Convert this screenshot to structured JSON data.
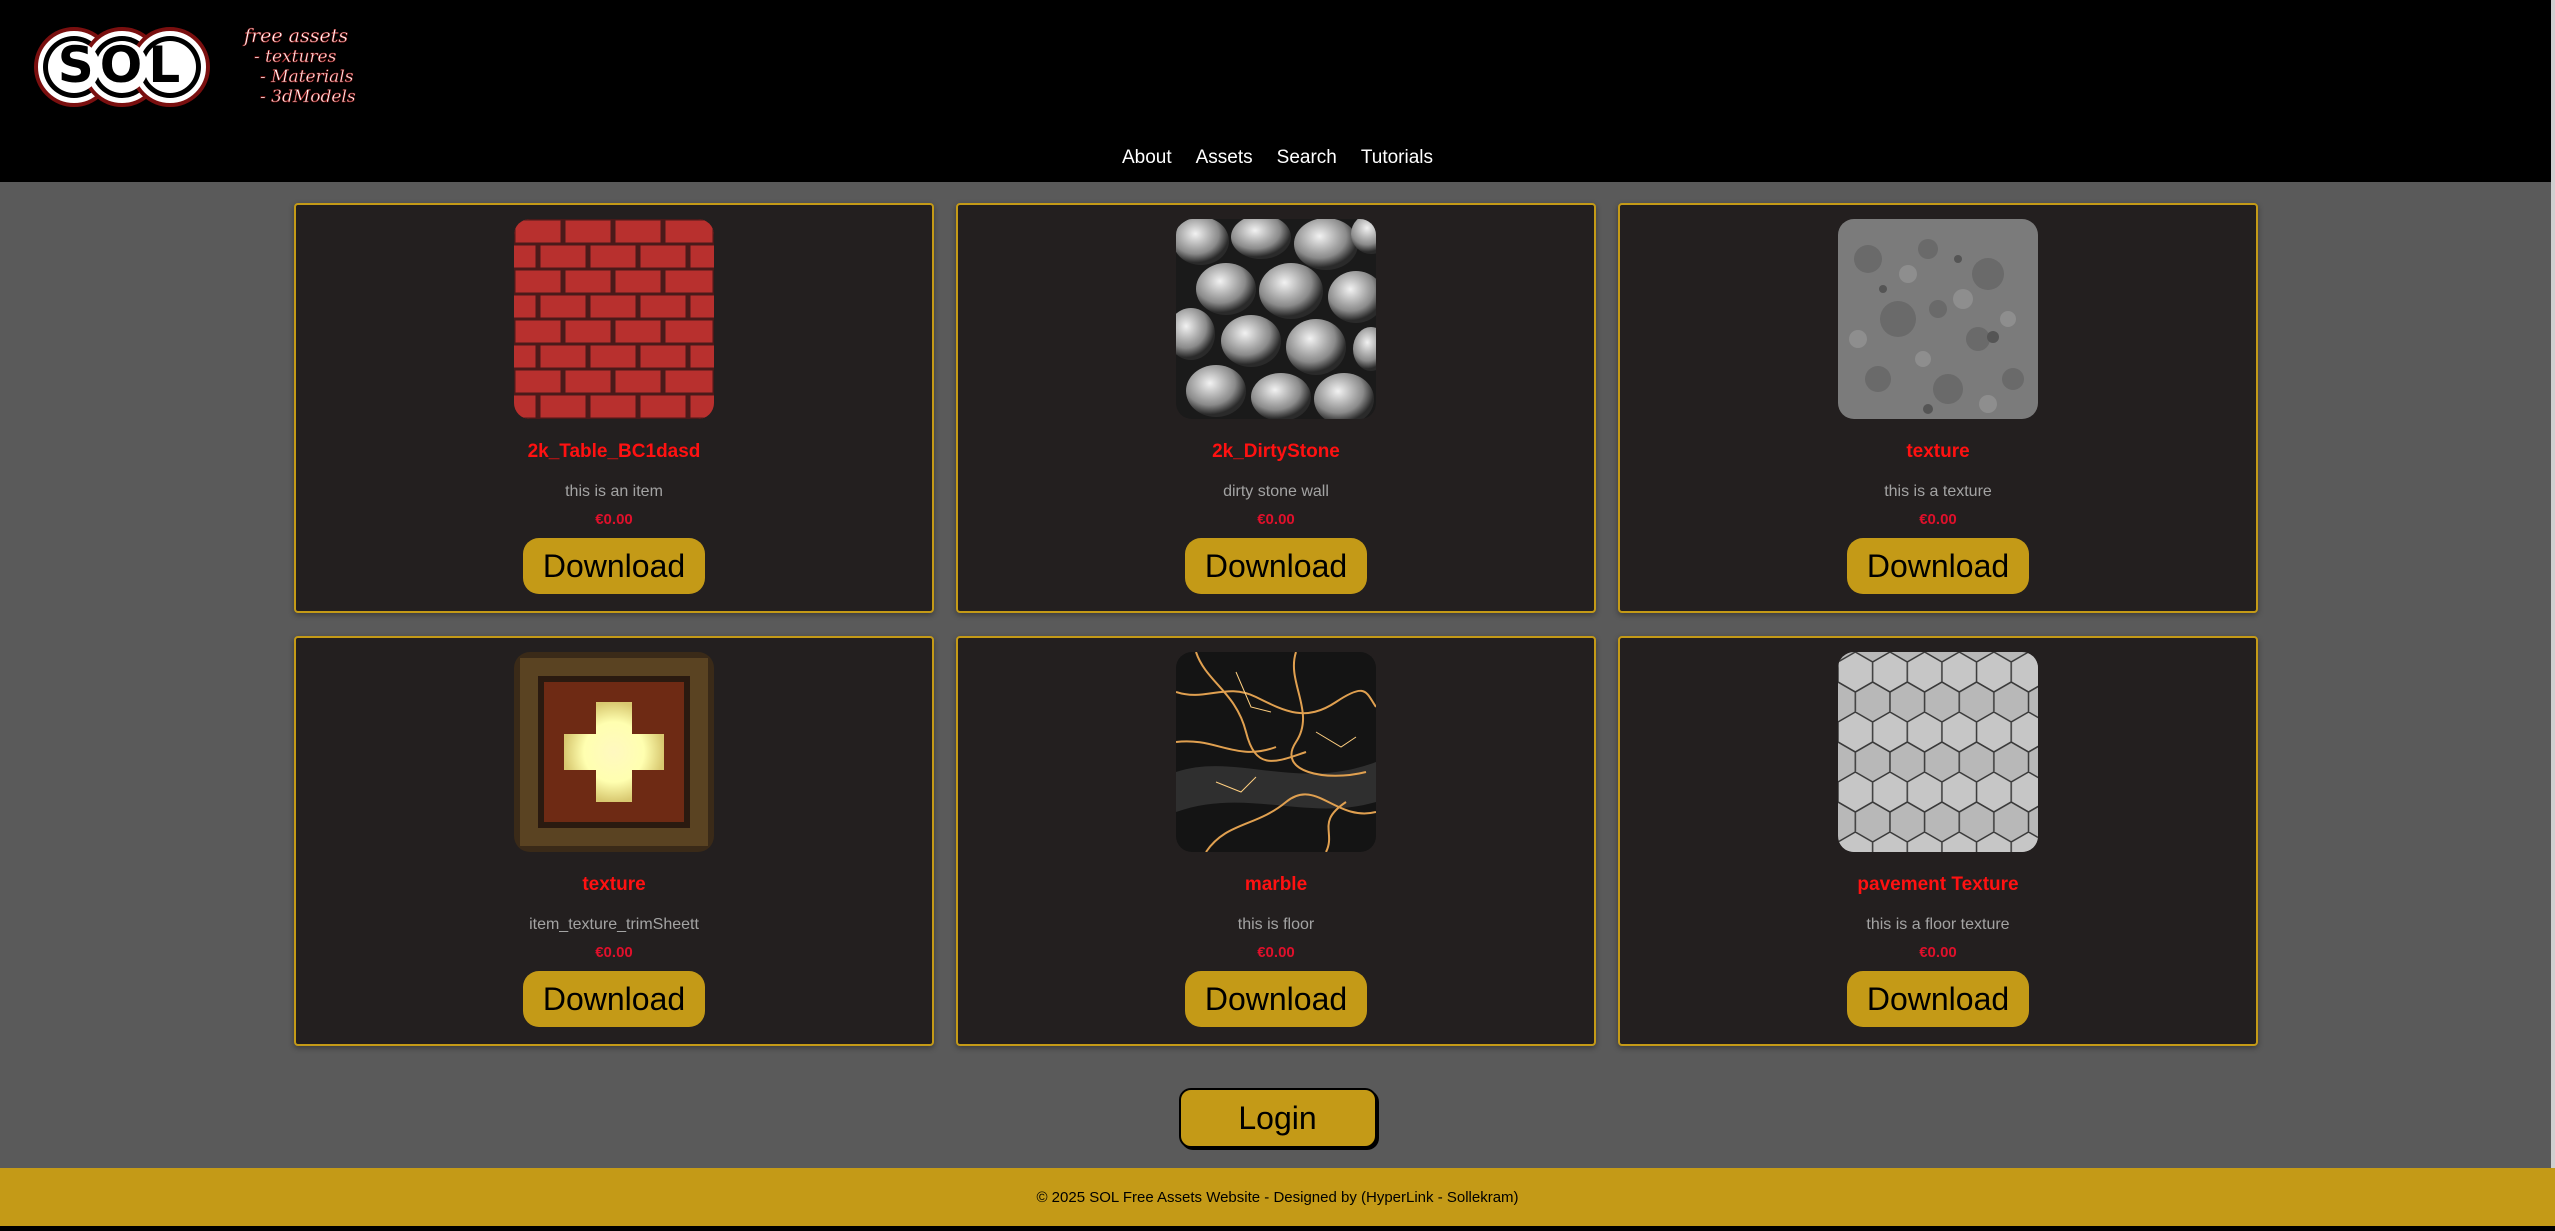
{
  "header": {
    "logo_text": "SOL",
    "logo_tagline": [
      "free assets",
      "- textures",
      "- Materials",
      "- 3dModels"
    ]
  },
  "nav": {
    "items": [
      {
        "label": "About"
      },
      {
        "label": "Assets"
      },
      {
        "label": "Search"
      },
      {
        "label": "Tutorials"
      }
    ]
  },
  "assets": [
    {
      "title": "2k_Table_BC1dasd",
      "description": "this is an item",
      "price": "€0.00",
      "button": "Download",
      "thumb": "red-brick-texture"
    },
    {
      "title": "2k_DirtyStone",
      "description": "dirty stone wall",
      "price": "€0.00",
      "button": "Download",
      "thumb": "dirty-stone-texture"
    },
    {
      "title": "texture",
      "description": "this is a texture",
      "price": "€0.00",
      "button": "Download",
      "thumb": "gray-concrete-texture"
    },
    {
      "title": "texture",
      "description": "item_texture_trimSheett",
      "price": "€0.00",
      "button": "Download",
      "thumb": "glowing-cross-tile-texture"
    },
    {
      "title": "marble",
      "description": "this is floor",
      "price": "€0.00",
      "button": "Download",
      "thumb": "black-gold-marble-texture"
    },
    {
      "title": "pavement Texture",
      "description": "this is a floor texture",
      "price": "€0.00",
      "button": "Download",
      "thumb": "hexagon-pavement-texture"
    }
  ],
  "login": {
    "label": "Login"
  },
  "footer": {
    "text": "© 2025 SOL Free Assets Website - Designed by (HyperLink - Sollekram)"
  },
  "colors": {
    "accent": "#c49a17",
    "card_bg": "#231f1f",
    "page_bg": "#5a5a5a",
    "title_red": "#ff1111",
    "price_red": "#e0102b"
  }
}
